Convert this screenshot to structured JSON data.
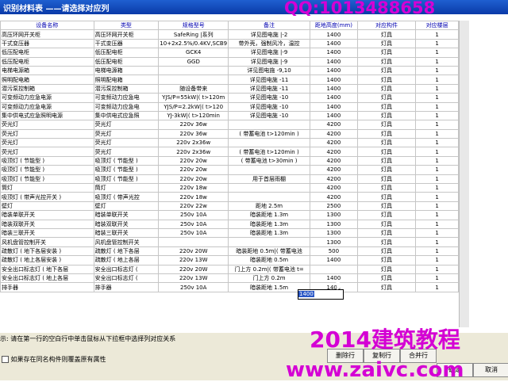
{
  "window": {
    "title": "识别材料表 ——请选择对应列"
  },
  "watermarks": {
    "qq": "QQ:1013488658",
    "brand": "2014建筑教程",
    "site": "www.zaivc.com"
  },
  "table": {
    "headers": [
      "设备名称",
      "类型",
      "规格型号",
      "备注",
      "距地高度(mm)",
      "对应构件",
      "对应楼层"
    ],
    "rows": [
      [
        "高压环网开关柜",
        "高压环网开关柜",
        "SafeRing |系列",
        "详见图电施 |-2",
        "1400",
        "灯具",
        "1"
      ],
      [
        "干式变压器",
        "干式变压器",
        "10+2x2.5%/0.4KV,SCB9",
        "带外壳，强制风冷，温控",
        "1400",
        "灯具",
        "1"
      ],
      [
        "低压配电柜",
        "低压配电柜",
        "GCK4",
        "详见图电施 |-9",
        "1400",
        "灯具",
        "1"
      ],
      [
        "低压配电柜",
        "低压配电柜",
        "GGD",
        "详见图电施 |-9",
        "1400",
        "灯具",
        "1"
      ],
      [
        "电梯电源箱",
        "电梯电源箱",
        "",
        "详见图电施 -9,10",
        "1400",
        "灯具",
        "1"
      ],
      [
        "照明配电箱",
        "照明配电箱",
        "",
        "详见图电施 -11",
        "1400",
        "灯具",
        "1"
      ],
      [
        "潜污泵控制箱",
        "潜污泵控制箱",
        "随设备带来",
        "详见图电施 -11",
        "1400",
        "灯具",
        "1"
      ],
      [
        "可变频动力应急电源",
        "可变频动力应急电",
        "YJS/P=55kW|(  t>120m",
        "详见图电施 -10",
        "1400",
        "灯具",
        "1"
      ],
      [
        "可变频动力应急电源",
        "可变频动力应急电",
        "YJS/P=2.2kW|(  t>120",
        "详见图电施 -10",
        "1400",
        "灯具",
        "1"
      ],
      [
        "集中供电式应急照明电源",
        "集中供电式应急照",
        "YJ-3kW|(  t>120min",
        "详见图电施 -10",
        "1400",
        "灯具",
        "1"
      ],
      [
        "荧光灯",
        "荧光灯",
        "220v   36w",
        "",
        "4200",
        "灯具",
        "1"
      ],
      [
        "荧光灯",
        "荧光灯",
        "220v   36w",
        "( 带蓄电池  t>120min )",
        "4200",
        "灯具",
        "1"
      ],
      [
        "荧光灯",
        "荧光灯",
        "220v   2x36w",
        "",
        "4200",
        "灯具",
        "1"
      ],
      [
        "荧光灯",
        "荧光灯",
        "220v   2x36w",
        "( 带蓄电池  t>120min )",
        "4200",
        "灯具",
        "1"
      ],
      [
        "吸顶灯 ( 节能型 )",
        "吸顶灯 ( 节能型 )",
        "220v   20w",
        "( 带蓄电池  t>30min )",
        "4200",
        "灯具",
        "1"
      ],
      [
        "吸顶灯 ( 节能型 )",
        "吸顶灯 ( 节能型 )",
        "220v   20w",
        "",
        "4200",
        "灯具",
        "1"
      ],
      [
        "吸顶灯 ( 节能型 )",
        "吸顶灯 ( 节能型 )",
        "220v   20w",
        "用于首层雨棚",
        "4200",
        "灯具",
        "1"
      ],
      [
        "筒灯",
        "筒灯",
        "220v   18w",
        "",
        "4200",
        "灯具",
        "1"
      ],
      [
        "吸顶灯 ( 带声光控开关 )",
        "吸顶灯 ( 带声光控",
        "220v   18w",
        "",
        "4200",
        "灯具",
        "1"
      ],
      [
        "壁灯",
        "壁灯",
        "220v   22w",
        "距地 2.5m",
        "2500",
        "灯具",
        "1"
      ],
      [
        "暗装单联开关",
        "暗装单联开关",
        "250v   10A",
        "暗装距地 1.3m",
        "1300",
        "灯具",
        "1"
      ],
      [
        "暗装双联开关",
        "暗装双联开关",
        "250v   10A",
        "暗装距地 1.3m",
        "1300",
        "灯具",
        "1"
      ],
      [
        "暗装三联开关",
        "暗装三联开关",
        "250v   10A",
        "暗装距地 1.3m",
        "1300",
        "灯具",
        "1"
      ],
      [
        "风机盘管控制开关",
        "风机盘管控制开关",
        "",
        "",
        "1300",
        "灯具",
        "1"
      ],
      [
        "疏散灯 ( 地下各层安装 )",
        "疏散灯 ( 地下各层",
        "220v   20W",
        "暗装距地 0.5m|( 带蓄电池",
        "500",
        "灯具",
        "1"
      ],
      [
        "疏散灯 ( 地上各层安装 )",
        "疏散灯 ( 地上各层",
        "220v   13W",
        "暗装距地 0.5m",
        "1400",
        "灯具",
        "1"
      ],
      [
        "安全出口标志灯 ( 地下各层",
        "安全出口标志灯 ( ",
        "220v   20W",
        "门上方 0.2m|( 带蓄电池  t=",
        "",
        "灯具",
        "1"
      ],
      [
        "安全出口标志灯 ( 地上各层",
        "安全出口标志灯 ( ",
        "220v   13W",
        "门上方 0.2m",
        "1400",
        "灯具",
        "1"
      ],
      [
        "排手器",
        "排手器",
        "250v   10A",
        "暗装距地 1.5m",
        "1400",
        "灯具",
        "1"
      ]
    ]
  },
  "edit_cell": {
    "value": "1400"
  },
  "hint": "示: 请在第一行的空白行中单击鼠标从下拉框中选择列对应关系",
  "checkbox_label": "如果存在同名构件则覆盖原有属性",
  "buttons": {
    "delete_row": "删除行",
    "copy_row": "复制行",
    "merge_row": "合并行",
    "ok": "确定",
    "cancel": "取消"
  }
}
